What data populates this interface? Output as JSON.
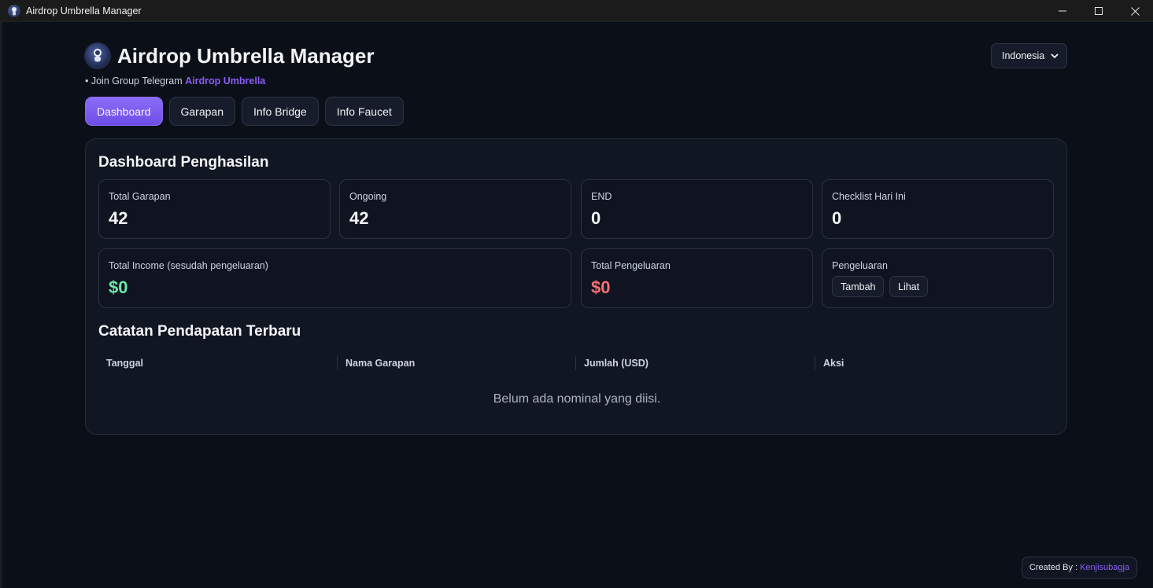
{
  "window": {
    "title": "Airdrop Umbrella Manager",
    "icon": "astronaut-icon"
  },
  "header": {
    "title": "Airdrop Umbrella Manager",
    "join_prefix": "• Join Group Telegram",
    "join_link": "Airdrop Umbrella",
    "language": "Indonesia"
  },
  "tabs": [
    {
      "label": "Dashboard",
      "active": true
    },
    {
      "label": "Garapan",
      "active": false
    },
    {
      "label": "Info Bridge",
      "active": false
    },
    {
      "label": "Info Faucet",
      "active": false
    }
  ],
  "dashboard": {
    "title": "Dashboard Penghasilan",
    "stats": [
      {
        "label": "Total Garapan",
        "value": "42"
      },
      {
        "label": "Ongoing",
        "value": "42"
      },
      {
        "label": "END",
        "value": "0"
      },
      {
        "label": "Checklist Hari Ini",
        "value": "0"
      }
    ],
    "income": {
      "label": "Total Income (sesudah pengeluaran)",
      "value": "$0"
    },
    "expenses": {
      "label": "Total Pengeluaran",
      "value": "$0"
    },
    "expense_actions": {
      "label": "Pengeluaran",
      "add_label": "Tambah",
      "view_label": "Lihat"
    }
  },
  "records": {
    "title": "Catatan Pendapatan Terbaru",
    "columns": [
      "Tanggal",
      "Nama Garapan",
      "Jumlah (USD)",
      "Aksi"
    ],
    "empty_message": "Belum ada nominal yang diisi."
  },
  "footer": {
    "created_by": "Created By :",
    "author": "Kenjisubagja"
  },
  "colors": {
    "accent": "#8b5cf6",
    "income": "#6ee7a8",
    "expense": "#f87171",
    "background": "#0b0f17"
  }
}
